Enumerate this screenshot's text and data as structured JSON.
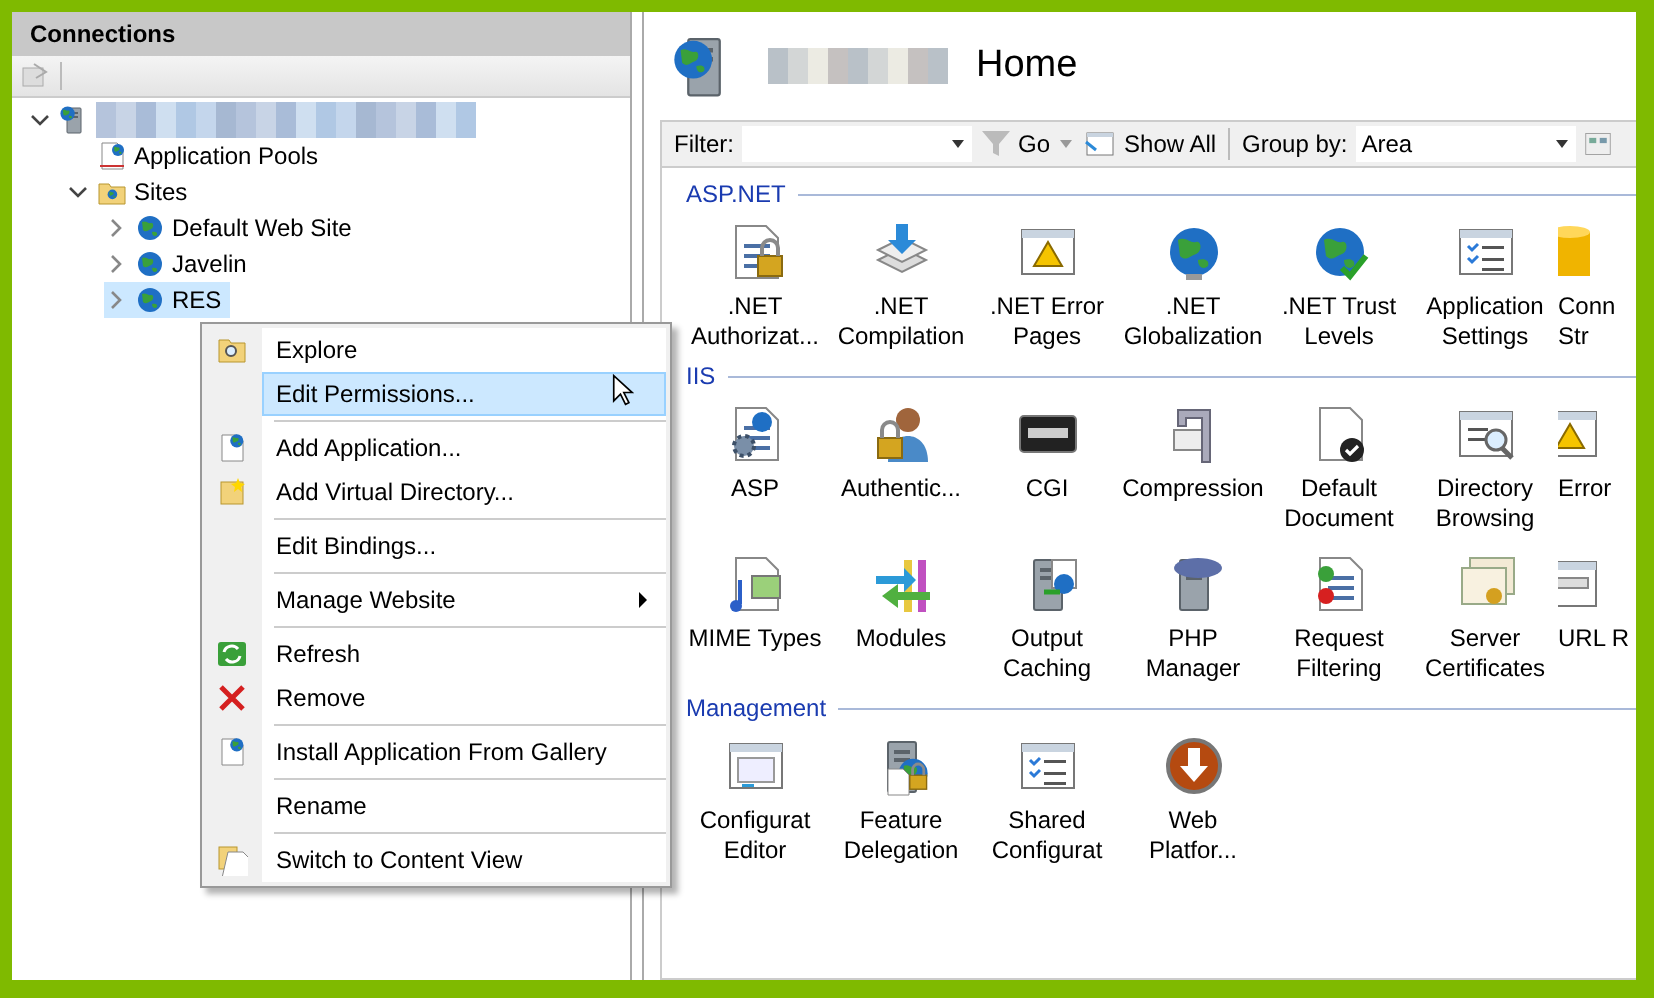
{
  "connections": {
    "title": "Connections",
    "tree": [
      {
        "kind": "server",
        "label_blurred": true,
        "expanded": true,
        "selected": false,
        "children": [
          {
            "kind": "pool",
            "label": "Application Pools",
            "selected": false
          },
          {
            "kind": "folder",
            "label": "Sites",
            "expanded": true,
            "selected": false,
            "children": [
              {
                "kind": "site",
                "label": "Default Web Site",
                "expanded": false,
                "selected": false
              },
              {
                "kind": "site",
                "label": "Javelin",
                "expanded": false,
                "selected": false
              },
              {
                "kind": "site",
                "label": "RES",
                "expanded": false,
                "selected": true
              }
            ]
          }
        ]
      }
    ]
  },
  "home": {
    "title": "Home",
    "title_blurred": true,
    "filter": {
      "label": "Filter:",
      "go": "Go",
      "go_disabled": true,
      "show_all": "Show All",
      "group_by_label": "Group by:",
      "group_by": "Area"
    },
    "groups": [
      {
        "title": "ASP.NET",
        "features": [
          {
            "label": ".NET\nAuthorizat..."
          },
          {
            "label": ".NET\nCompilation"
          },
          {
            "label": ".NET Error\nPages"
          },
          {
            "label": ".NET\nGlobalization"
          },
          {
            "label": ".NET Trust\nLevels"
          },
          {
            "label": "Application\nSettings"
          },
          {
            "label": "Conn\nStr"
          }
        ]
      },
      {
        "title": "IIS",
        "features": [
          {
            "label": "ASP"
          },
          {
            "label": "Authentic..."
          },
          {
            "label": "CGI"
          },
          {
            "label": "Compression"
          },
          {
            "label": "Default\nDocument"
          },
          {
            "label": "Directory\nBrowsing"
          },
          {
            "label": "Error"
          },
          {
            "label": "MIME Types"
          },
          {
            "label": "Modules"
          },
          {
            "label": "Output\nCaching"
          },
          {
            "label": "PHP\nManager"
          },
          {
            "label": "Request\nFiltering"
          },
          {
            "label": "Server\nCertificates"
          },
          {
            "label": "URL R"
          }
        ]
      },
      {
        "title": "Management",
        "features": [
          {
            "label": "Configurat\nEditor"
          },
          {
            "label": "Feature\nDelegation"
          },
          {
            "label": "Shared\nConfigurat"
          },
          {
            "label": "Web\nPlatfor..."
          }
        ]
      }
    ]
  },
  "context_menu": {
    "groups": [
      [
        {
          "label": "Explore",
          "selected": false,
          "submenu": false
        },
        {
          "label": "Edit Permissions...",
          "selected": true,
          "submenu": false
        }
      ],
      [
        {
          "label": "Add Application...",
          "selected": false,
          "submenu": false
        },
        {
          "label": "Add Virtual Directory...",
          "selected": false,
          "submenu": false
        }
      ],
      [
        {
          "label": "Edit Bindings...",
          "selected": false,
          "submenu": false
        }
      ],
      [
        {
          "label": "Manage Website",
          "selected": false,
          "submenu": true
        }
      ],
      [
        {
          "label": "Refresh",
          "selected": false,
          "submenu": false
        },
        {
          "label": "Remove",
          "selected": false,
          "submenu": false
        }
      ],
      [
        {
          "label": "Install Application From Gallery",
          "selected": false,
          "submenu": false
        }
      ],
      [
        {
          "label": "Rename",
          "selected": false,
          "submenu": false
        }
      ],
      [
        {
          "label": "Switch to Content View",
          "selected": false,
          "submenu": false
        }
      ]
    ]
  }
}
